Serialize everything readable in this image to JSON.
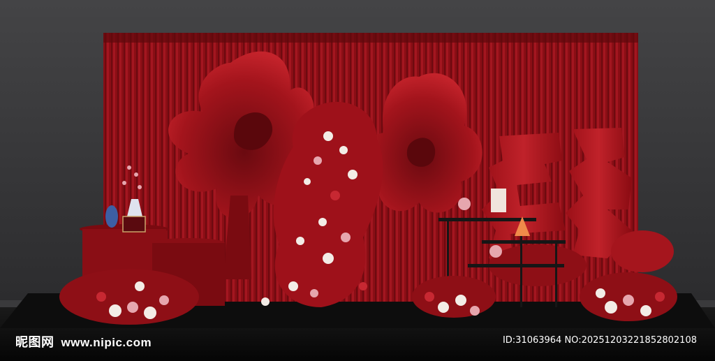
{
  "watermark": {
    "logo_text": "昵图网",
    "site_url": "www.nipic.com",
    "id_text": "ID:31063964 NO:20251203221852802108"
  },
  "scene": {
    "subject": "red-wedding-stage-backdrop",
    "colors": {
      "wall": "#3a3a3c",
      "floor": "#111111",
      "curtain": "#8e0f16",
      "flower_red": "#b5141e",
      "rose_white": "#f3ece6",
      "rose_pink": "#e6a6ae",
      "table_black": "#161616"
    },
    "elements": [
      "red-curtain",
      "giant-paper-flowers",
      "floral-column",
      "double-happiness-sculpture",
      "dessert-stand",
      "vase-side-table",
      "floor-flower-clusters"
    ]
  }
}
